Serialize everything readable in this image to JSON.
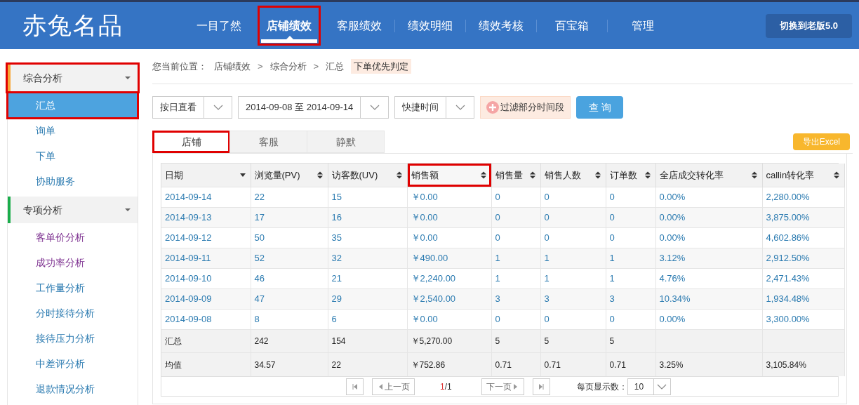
{
  "header": {
    "logo": "赤兔名品",
    "nav": [
      {
        "label": "一目了然",
        "selected": false,
        "highlighted": false
      },
      {
        "label": "店铺绩效",
        "selected": true,
        "highlighted": true
      },
      {
        "label": "客服绩效",
        "selected": false,
        "highlighted": false
      },
      {
        "label": "绩效明细",
        "selected": false,
        "highlighted": false
      },
      {
        "label": "绩效考核",
        "selected": false,
        "highlighted": false
      },
      {
        "label": "百宝箱",
        "selected": false,
        "highlighted": false
      },
      {
        "label": "管理",
        "selected": false,
        "highlighted": false
      }
    ],
    "switch_button": "切换到老版5.0"
  },
  "sidebar": {
    "groups": [
      {
        "label": "综合分析",
        "color": "#f7a535",
        "highlighted": true,
        "children": [
          {
            "label": "汇总",
            "selected": true,
            "visited": false,
            "highlighted": true
          },
          {
            "label": "询单",
            "selected": false,
            "visited": false,
            "highlighted": false
          },
          {
            "label": "下单",
            "selected": false,
            "visited": false,
            "highlighted": false
          },
          {
            "label": "协助服务",
            "selected": false,
            "visited": false,
            "highlighted": false
          }
        ]
      },
      {
        "label": "专项分析",
        "color": "#1aad4b",
        "highlighted": false,
        "children": [
          {
            "label": "客单价分析",
            "selected": false,
            "visited": true,
            "highlighted": false
          },
          {
            "label": "成功率分析",
            "selected": false,
            "visited": true,
            "highlighted": false
          },
          {
            "label": "工作量分析",
            "selected": false,
            "visited": false,
            "highlighted": false
          },
          {
            "label": "分时接待分析",
            "selected": false,
            "visited": false,
            "highlighted": false
          },
          {
            "label": "接待压力分析",
            "selected": false,
            "visited": false,
            "highlighted": false
          },
          {
            "label": "中差评分析",
            "selected": false,
            "visited": false,
            "highlighted": false
          },
          {
            "label": "退款情况分析",
            "selected": false,
            "visited": false,
            "highlighted": false
          }
        ]
      }
    ]
  },
  "breadcrumb": {
    "label": "您当前位置：",
    "items": [
      {
        "kind": "link",
        "text": "店铺绩效"
      },
      {
        "kind": "separator",
        "text": ">"
      },
      {
        "kind": "link",
        "text": "综合分析"
      },
      {
        "kind": "separator",
        "text": ">"
      },
      {
        "kind": "link",
        "text": "汇总"
      }
    ],
    "badge": "下单优先判定"
  },
  "filters": {
    "view_mode": "按日直看",
    "date_range": "2014-09-08 至 2014-09-14",
    "quick_time": "快捷时间",
    "filter_button": "过滤部分时间段",
    "query_button": "查 询"
  },
  "tabs": [
    {
      "label": "店铺",
      "selected": true,
      "highlighted": true
    },
    {
      "label": "客服",
      "selected": false,
      "highlighted": false
    },
    {
      "label": "静默",
      "selected": false,
      "highlighted": false
    }
  ],
  "export_button": "导出Excel",
  "table": {
    "columns": [
      {
        "label": "日期",
        "sorted": true,
        "highlighted": false
      },
      {
        "label": "浏览量(PV)",
        "sorted": false,
        "highlighted": false
      },
      {
        "label": "访客数(UV)",
        "sorted": false,
        "highlighted": false
      },
      {
        "label": "销售额",
        "sorted": false,
        "highlighted": true
      },
      {
        "label": "销售量",
        "sorted": false,
        "highlighted": false
      },
      {
        "label": "销售人数",
        "sorted": false,
        "highlighted": false
      },
      {
        "label": "订单数",
        "sorted": false,
        "highlighted": false
      },
      {
        "label": "全店成交转化率",
        "sorted": false,
        "highlighted": false
      },
      {
        "label": "callin转化率",
        "sorted": false,
        "highlighted": false
      }
    ],
    "rows": [
      {
        "kind": "data",
        "cells": [
          "2014-09-14",
          "22",
          "15",
          "￥0.00",
          "0",
          "0",
          "0",
          "0.00%",
          "2,280.00%"
        ]
      },
      {
        "kind": "data",
        "cells": [
          "2014-09-13",
          "17",
          "16",
          "￥0.00",
          "0",
          "0",
          "0",
          "0.00%",
          "3,875.00%"
        ]
      },
      {
        "kind": "data",
        "cells": [
          "2014-09-12",
          "50",
          "35",
          "￥0.00",
          "0",
          "0",
          "0",
          "0.00%",
          "4,602.86%"
        ]
      },
      {
        "kind": "data",
        "cells": [
          "2014-09-11",
          "52",
          "32",
          "￥490.00",
          "1",
          "1",
          "1",
          "3.12%",
          "2,912.50%"
        ]
      },
      {
        "kind": "data",
        "cells": [
          "2014-09-10",
          "46",
          "21",
          "￥2,240.00",
          "1",
          "1",
          "1",
          "4.76%",
          "2,471.43%"
        ]
      },
      {
        "kind": "data",
        "cells": [
          "2014-09-09",
          "47",
          "29",
          "￥2,540.00",
          "3",
          "3",
          "3",
          "10.34%",
          "1,934.48%"
        ]
      },
      {
        "kind": "data",
        "cells": [
          "2014-09-08",
          "8",
          "6",
          "￥0.00",
          "0",
          "0",
          "0",
          "0.00%",
          "3,300.00%"
        ]
      },
      {
        "kind": "summary",
        "cells": [
          "汇总",
          "242",
          "154",
          "￥5,270.00",
          "5",
          "5",
          "5",
          "",
          ""
        ]
      },
      {
        "kind": "summary",
        "cells": [
          "均值",
          "34.57",
          "22",
          "￥752.86",
          "0.71",
          "0.71",
          "0.71",
          "3.25%",
          "3,105.84%"
        ]
      }
    ]
  },
  "pager": {
    "prev": "上一页",
    "current": "1",
    "total": "/1",
    "next": "下一页",
    "page_size_label": "每页显示数：",
    "page_size": "10"
  }
}
